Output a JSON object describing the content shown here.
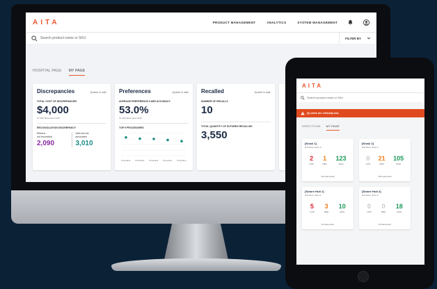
{
  "colors": {
    "background": "#0b2136",
    "accent": "#e8572e",
    "title": "#1c2a44",
    "red": "#d5262d",
    "orange": "#ef7d17",
    "green": "#1d9a5a",
    "grey": "#c4c7cb",
    "purple": "#8a2da0",
    "teal": "#1b8c84",
    "alert": "#e04a1f"
  },
  "brand": "AITA",
  "desktop": {
    "nav": [
      "PRODUCT MANAGEMENT",
      "ANALYTICS",
      "SYSTEM MANAGEMENT"
    ],
    "search_placeholder": "Search product name or SKU",
    "filter_label": "FILTER BY",
    "tabs": [
      "HOSPITAL PAGE",
      "MY PAGE"
    ],
    "active_tab": "MY PAGE",
    "cards": {
      "discrepancies": {
        "title": "Discrepancies",
        "subtitle": "Quarter to date",
        "metric_label": "TOTAL COST OF DISCREPANCIES",
        "metric_value": "$4,000",
        "delta": "▼ 13% Since last month",
        "section_label": "RECONCILIATION DISCREPANCY",
        "left_label_1": "Returns",
        "left_label_2": "not reconciled",
        "left_value": "2,090",
        "right_label_1": "Add-ons not",
        "right_label_2": "accounted",
        "right_value": "3,010"
      },
      "preferences": {
        "title": "Preferences",
        "subtitle": "Quarter to date",
        "metric_label": "AVERAGE PREFERENCE CARD ACCURACY",
        "metric_value": "53.0%",
        "delta": "▼ 13% Since last month",
        "section_label": "TOP 5 PROCEDURES"
      },
      "recalled": {
        "title": "Recalled",
        "subtitle": "Quarter to date",
        "metric_label": "NUMBER OF RECALLS",
        "metric_value": "10",
        "section_label": "TOTAL QUANTITY OF SUTURES RECALLED",
        "section_value": "3,550"
      }
    }
  },
  "chart_data": {
    "type": "scatter",
    "title": "TOP 5 PROCEDURES",
    "categories": [
      "Procedure",
      "Procedure",
      "Procedure",
      "Procedure",
      "Procedure"
    ],
    "values": [
      82,
      76,
      75,
      70,
      65
    ],
    "ylim": [
      0,
      100
    ],
    "grid": true,
    "color": "#1b8c84"
  },
  "tablet": {
    "search_placeholder": "Search product name or SKU",
    "alert": "[4] units are critically low.",
    "tabs": [
      "DIRECTIONS",
      "MY PAGE"
    ],
    "active_tab": "MY PAGE",
    "kiosks": [
      {
        "name": "[Kiosk 1]",
        "location": "2nd Floor, Zone 2",
        "values": [
          "2",
          "1",
          "123"
        ],
        "colors": [
          "c-red",
          "c-orange",
          "c-green"
        ],
        "labels": [
          "LOW",
          "MED",
          "HIGH"
        ],
        "footer": "144 total stocks"
      },
      {
        "name": "[Kiosk 2]",
        "location": "2nd Floor, Zone 2",
        "values": [
          "0",
          "21",
          "105"
        ],
        "colors": [
          "c-grey",
          "c-orange",
          "c-green"
        ],
        "labels": [
          "LOW",
          "MED",
          "HIGH"
        ],
        "footer": "136 total stocks"
      },
      {
        "name": "[Suture Hub 1]",
        "location": "2nd Floor, Zone 2",
        "values": [
          "5",
          "3",
          "10"
        ],
        "colors": [
          "c-red",
          "c-orange",
          "c-green"
        ],
        "labels": [
          "LOW",
          "MED",
          "HIGH"
        ],
        "footer": "18 total stocks"
      },
      {
        "name": "[Suture Hub 2]",
        "location": "2nd Floor, Zone 2",
        "values": [
          "0",
          "0",
          "18"
        ],
        "colors": [
          "c-grey",
          "c-grey",
          "c-green"
        ],
        "labels": [
          "LOW",
          "MED",
          "HIGH"
        ],
        "footer": "18 total stocks"
      }
    ]
  }
}
